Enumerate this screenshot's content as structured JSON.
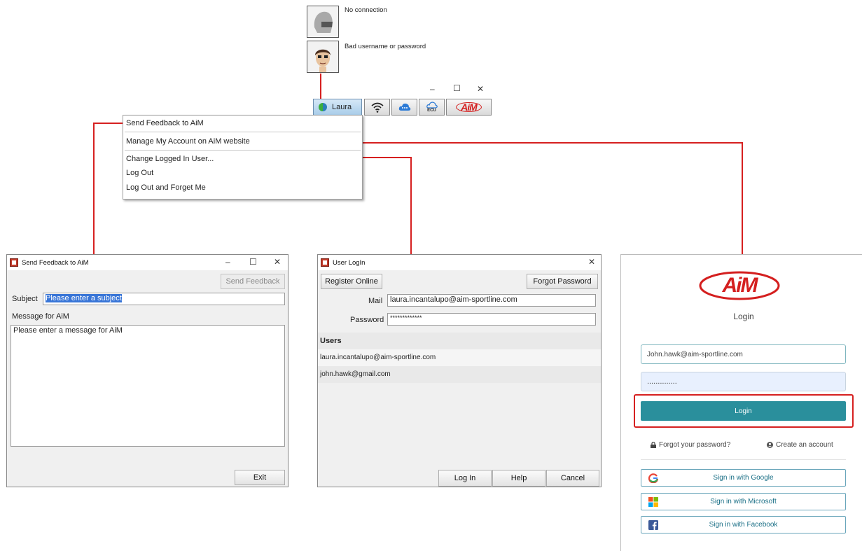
{
  "status": {
    "no_connection": "No connection",
    "bad_login": "Bad username or password"
  },
  "toolbar": {
    "minimize": "–",
    "maximize": "☐",
    "close": "✕",
    "user_name": "Laura",
    "ecu_label": "ECU",
    "brand_logo": "AiM"
  },
  "menu": {
    "items": [
      "Send Feedback to AiM",
      "Manage My Account on AiM website",
      "Change Logged In User...",
      "Log Out",
      "Log Out and Forget Me"
    ]
  },
  "feedback": {
    "title": "Send Feedback to AiM",
    "send_button": "Send Feedback",
    "subject_label": "Subject",
    "subject_value": "Please enter a subject",
    "message_label": "Message for AiM",
    "message_value": "Please enter a message for AiM",
    "exit_button": "Exit"
  },
  "login": {
    "title": "User LogIn",
    "register_button": "Register Online",
    "forgot_button": "Forgot Password",
    "mail_label": "Mail",
    "mail_value": "laura.incantalupo@aim-sportline.com",
    "password_label": "Password",
    "password_value": "*************",
    "users_header": "Users",
    "users": [
      "laura.incantalupo@aim-sportline.com",
      "john.hawk@gmail.com"
    ],
    "login_button": "Log In",
    "help_button": "Help",
    "cancel_button": "Cancel"
  },
  "web": {
    "logo": "AiM",
    "heading": "Login",
    "email_value": "John.hawk@aim-sportline.com",
    "password_value": "..............",
    "login_button": "Login",
    "forgot_link": "Forgot your password?",
    "create_link": "Create an account",
    "google_button": "Sign in with Google",
    "microsoft_button": "Sign in with Microsoft",
    "facebook_button": "Sign in with Facebook"
  },
  "colors": {
    "accent_red": "#d62020",
    "brand_teal": "#2a8f9c",
    "selection_blue": "#3875d7"
  }
}
